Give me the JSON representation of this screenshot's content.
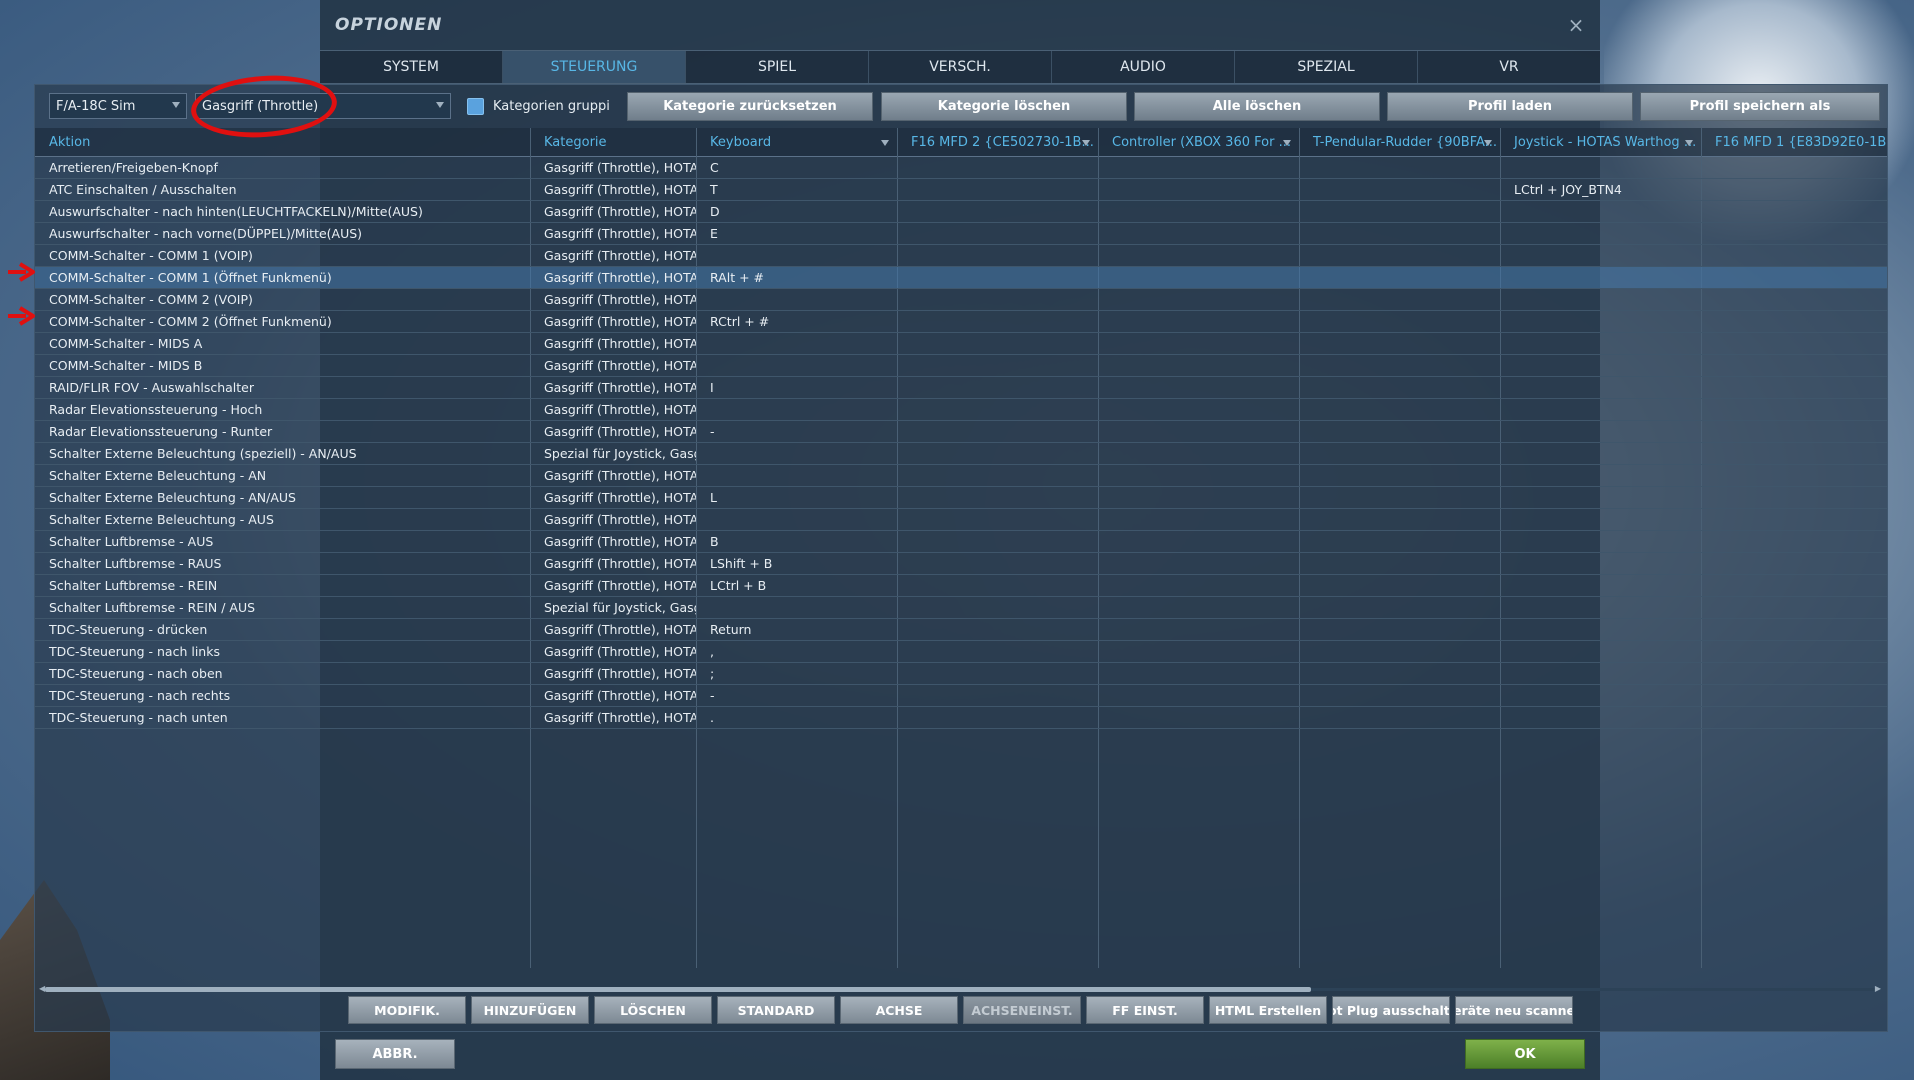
{
  "dialog": {
    "title": "OPTIONEN",
    "close_icon": "×"
  },
  "tabs": [
    {
      "label": "SYSTEM",
      "active": false
    },
    {
      "label": "STEUERUNG",
      "active": true
    },
    {
      "label": "SPIEL",
      "active": false
    },
    {
      "label": "VERSCH.",
      "active": false
    },
    {
      "label": "AUDIO",
      "active": false
    },
    {
      "label": "SPEZIAL",
      "active": false
    },
    {
      "label": "VR",
      "active": false
    }
  ],
  "toolbar": {
    "aircraft_select": "F/A-18C Sim",
    "category_select": "Gasgriff (Throttle)",
    "group_checkbox_label": "Kategorien gruppi",
    "buttons": [
      "Kategorie zurücksetzen",
      "Kategorie löschen",
      "Alle löschen",
      "Profil laden",
      "Profil speichern als"
    ]
  },
  "table": {
    "headers": [
      "Aktion",
      "Kategorie",
      "Keyboard",
      "F16 MFD 2 {CE502730-1B...",
      "Controller (XBOX 360 For ...",
      "T-Pendular-Rudder {90BFA...",
      "Joystick - HOTAS Warthog ...",
      "F16 MFD 1 {E83D92E0-1B..."
    ],
    "rows": [
      [
        "Arretieren/Freigeben-Knopf",
        "Gasgriff (Throttle), HOTAS",
        "C",
        "",
        "",
        "",
        "",
        ""
      ],
      [
        "ATC Einschalten / Ausschalten",
        "Gasgriff (Throttle), HOTAS",
        "T",
        "",
        "",
        "",
        "LCtrl + JOY_BTN4",
        ""
      ],
      [
        "Auswurfschalter - nach hinten(LEUCHTFACKELN)/Mitte(AUS)",
        "Gasgriff (Throttle), HOTAS",
        "D",
        "",
        "",
        "",
        "",
        ""
      ],
      [
        "Auswurfschalter - nach vorne(DÜPPEL)/Mitte(AUS)",
        "Gasgriff (Throttle), HOTAS",
        "E",
        "",
        "",
        "",
        "",
        ""
      ],
      [
        "COMM-Schalter - COMM 1 (VOIP)",
        "Gasgriff (Throttle), HOTAS",
        "",
        "",
        "",
        "",
        "",
        ""
      ],
      [
        "COMM-Schalter - COMM 1 (Öffnet Funkmenü)",
        "Gasgriff (Throttle), HOTAS",
        "RAlt + #",
        "",
        "",
        "",
        "",
        ""
      ],
      [
        "COMM-Schalter - COMM 2 (VOIP)",
        "Gasgriff (Throttle), HOTAS",
        "",
        "",
        "",
        "",
        "",
        ""
      ],
      [
        "COMM-Schalter - COMM 2 (Öffnet Funkmenü)",
        "Gasgriff (Throttle), HOTAS",
        "RCtrl + #",
        "",
        "",
        "",
        "",
        ""
      ],
      [
        "COMM-Schalter - MIDS A",
        "Gasgriff (Throttle), HOTAS",
        "",
        "",
        "",
        "",
        "",
        ""
      ],
      [
        "COMM-Schalter - MIDS B",
        "Gasgriff (Throttle), HOTAS",
        "",
        "",
        "",
        "",
        "",
        ""
      ],
      [
        "RAID/FLIR FOV - Auswahlschalter",
        "Gasgriff (Throttle), HOTAS",
        "I",
        "",
        "",
        "",
        "",
        ""
      ],
      [
        "Radar Elevationssteuerung - Hoch",
        "Gasgriff (Throttle), HOTAS",
        "",
        "",
        "",
        "",
        "",
        ""
      ],
      [
        "Radar Elevationssteuerung - Runter",
        "Gasgriff (Throttle), HOTAS",
        "-",
        "",
        "",
        "",
        "",
        ""
      ],
      [
        "Schalter Externe Beleuchtung (speziell) - AN/AUS",
        "Spezial für Joystick, Gasgriff",
        "",
        "",
        "",
        "",
        "",
        ""
      ],
      [
        "Schalter Externe Beleuchtung - AN",
        "Gasgriff (Throttle), HOTAS",
        "",
        "",
        "",
        "",
        "",
        ""
      ],
      [
        "Schalter Externe Beleuchtung - AN/AUS",
        "Gasgriff (Throttle), HOTAS",
        "L",
        "",
        "",
        "",
        "",
        ""
      ],
      [
        "Schalter Externe Beleuchtung - AUS",
        "Gasgriff (Throttle), HOTAS",
        "",
        "",
        "",
        "",
        "",
        ""
      ],
      [
        "Schalter Luftbremse - AUS",
        "Gasgriff (Throttle), HOTAS",
        "B",
        "",
        "",
        "",
        "",
        ""
      ],
      [
        "Schalter Luftbremse - RAUS",
        "Gasgriff (Throttle), HOTAS",
        "LShift + B",
        "",
        "",
        "",
        "",
        ""
      ],
      [
        "Schalter Luftbremse - REIN",
        "Gasgriff (Throttle), HOTAS",
        "LCtrl + B",
        "",
        "",
        "",
        "",
        ""
      ],
      [
        "Schalter Luftbremse - REIN / AUS",
        "Spezial für Joystick, Gasgriff",
        "",
        "",
        "",
        "",
        "",
        ""
      ],
      [
        "TDC-Steuerung - drücken",
        "Gasgriff (Throttle), HOTAS",
        "Return",
        "",
        "",
        "",
        "",
        ""
      ],
      [
        "TDC-Steuerung - nach links",
        "Gasgriff (Throttle), HOTAS",
        ",",
        "",
        "",
        "",
        "",
        ""
      ],
      [
        "TDC-Steuerung - nach oben",
        "Gasgriff (Throttle), HOTAS",
        ";",
        "",
        "",
        "",
        "",
        ""
      ],
      [
        "TDC-Steuerung - nach rechts",
        "Gasgriff (Throttle), HOTAS",
        "-",
        "",
        "",
        "",
        "",
        ""
      ],
      [
        "TDC-Steuerung - nach unten",
        "Gasgriff (Throttle), HOTAS",
        ".",
        "",
        "",
        "",
        "",
        ""
      ]
    ],
    "selected_row": 5,
    "scroll_position": 0
  },
  "bottom_buttons": [
    {
      "label": "MODIFIK.",
      "enabled": true
    },
    {
      "label": "HINZUFÜGEN",
      "enabled": true
    },
    {
      "label": "LÖSCHEN",
      "enabled": true
    },
    {
      "label": "STANDARD",
      "enabled": true
    },
    {
      "label": "ACHSE",
      "enabled": true
    },
    {
      "label": "ACHSENEINST.",
      "enabled": false
    },
    {
      "label": "FF EINST.",
      "enabled": true
    },
    {
      "label": "HTML Erstellen",
      "enabled": true
    },
    {
      "label": "lot Plug ausschalte",
      "enabled": true
    },
    {
      "label": "eräte neu scanne",
      "enabled": true
    }
  ],
  "footer": {
    "cancel_label": "ABBR.",
    "ok_label": "OK"
  },
  "colors": {
    "accent": "#58b7e6",
    "ok": "#5a8f30",
    "annotation": "#e01010",
    "selected_row": "#46789a"
  }
}
